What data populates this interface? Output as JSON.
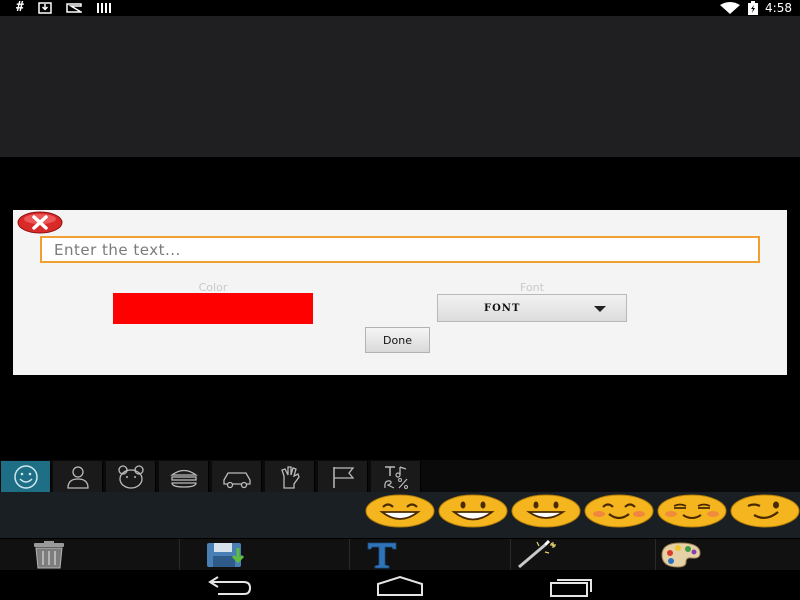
{
  "status_bar": {
    "left_hash": "#",
    "time": "4:58",
    "icons": [
      "download-icon",
      "play-store-icon",
      "barcode-icon",
      "wifi-icon",
      "battery-icon"
    ]
  },
  "dialog": {
    "text_input": {
      "value": "",
      "placeholder": "Enter the text..."
    },
    "color_label": "Color",
    "selected_color": "#ff0000",
    "font_label": "Font",
    "font_select_value": "FONT",
    "done_label": "Done"
  },
  "category_tabs": [
    {
      "icon": "smiley-icon",
      "active": true
    },
    {
      "icon": "person-icon",
      "active": false
    },
    {
      "icon": "animal-icon",
      "active": false
    },
    {
      "icon": "food-icon",
      "active": false
    },
    {
      "icon": "vehicle-icon",
      "active": false
    },
    {
      "icon": "hand-icon",
      "active": false
    },
    {
      "icon": "flag-icon",
      "active": false
    },
    {
      "icon": "text-symbols-icon",
      "active": false
    }
  ],
  "emojis": [
    "grinning-emoji",
    "big-smile-emoji",
    "smile-emoji",
    "blush-emoji",
    "content-emoji",
    "wink-emoji"
  ],
  "toolbar": [
    "trash-icon",
    "save-icon",
    "text-icon",
    "magic-wand-icon",
    "palette-icon"
  ],
  "nav": [
    "back-icon",
    "home-icon",
    "recent-apps-icon"
  ],
  "colors": {
    "accent": "#1e6f86",
    "input_border": "#f0a030",
    "swatch": "#ff0000"
  }
}
